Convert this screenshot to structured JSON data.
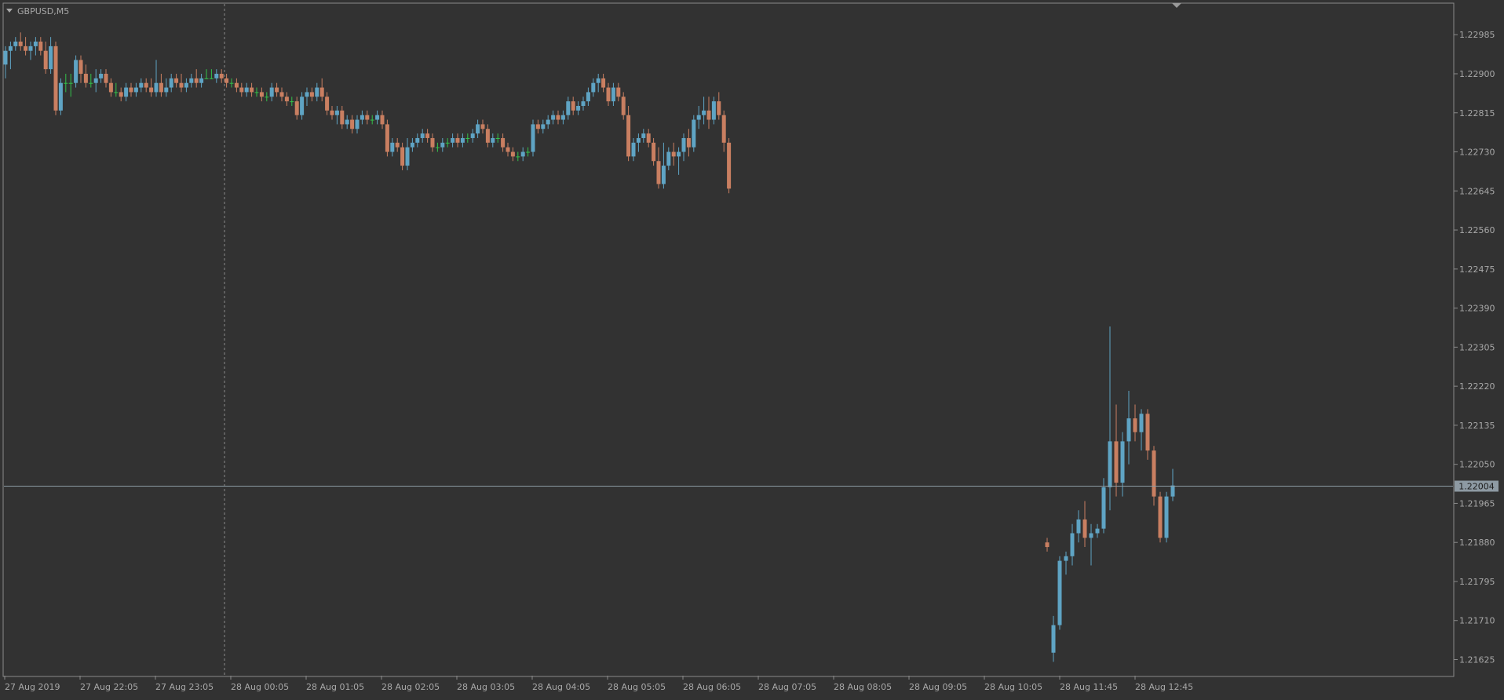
{
  "window": {
    "symbol_label": "GBPUSD,M5"
  },
  "colors": {
    "background": "#323232",
    "frame": "#8a8a8a",
    "text": "#a8a8a8",
    "bull": "#5fa4c4",
    "bear": "#c97f61",
    "doji": "#33c24a",
    "bid_line": "#8c9ca4",
    "bid_label_bg": "#8e9aa3",
    "bid_label_text": "#1c1c1c",
    "period_separator": "#8a8a8a"
  },
  "chart_data": {
    "type": "candlestick",
    "symbol": "GBPUSD",
    "timeframe": "M5",
    "y_range": [
      1.2159,
      1.23052
    ],
    "y_ticks": [
      "1.22985",
      "1.22900",
      "1.22815",
      "1.22730",
      "1.22645",
      "1.22560",
      "1.22475",
      "1.22390",
      "1.22305",
      "1.22220",
      "1.22135",
      "1.22050",
      "1.21965",
      "1.21880",
      "1.21795",
      "1.21710",
      "1.21625"
    ],
    "x_ticks": [
      "27 Aug 2019",
      "27 Aug 22:05",
      "27 Aug 23:05",
      "28 Aug 00:05",
      "28 Aug 01:05",
      "28 Aug 02:05",
      "28 Aug 03:05",
      "28 Aug 04:05",
      "28 Aug 05:05",
      "28 Aug 06:05",
      "28 Aug 07:05",
      "28 Aug 08:05",
      "28 Aug 09:05",
      "28 Aug 10:05",
      "28 Aug 11:45",
      "28 Aug 12:45"
    ],
    "current_bid": "1.22004",
    "candles": [
      [
        1.2292,
        1.2296,
        1.2289,
        1.2295
      ],
      [
        1.2295,
        1.2297,
        1.2291,
        1.2296
      ],
      [
        1.2296,
        1.2298,
        1.2295,
        1.2297
      ],
      [
        1.2297,
        1.2299,
        1.2295,
        1.2296
      ],
      [
        1.2296,
        1.2298,
        1.2294,
        1.2295
      ],
      [
        1.2295,
        1.2297,
        1.2293,
        1.2296
      ],
      [
        1.2296,
        1.2298,
        1.2294,
        1.2297
      ],
      [
        1.2297,
        1.2298,
        1.2294,
        1.2295
      ],
      [
        1.2295,
        1.2297,
        1.229,
        1.2291
      ],
      [
        1.2291,
        1.2298,
        1.229,
        1.2296
      ],
      [
        1.2296,
        1.2297,
        1.2281,
        1.2282
      ],
      [
        1.2282,
        1.2289,
        1.2281,
        1.2288
      ],
      [
        1.2288,
        1.229,
        1.2286,
        1.2288
      ],
      [
        1.2288,
        1.229,
        1.2285,
        1.2288
      ],
      [
        1.2288,
        1.2294,
        1.2287,
        1.2293
      ],
      [
        1.2293,
        1.2294,
        1.2288,
        1.229
      ],
      [
        1.229,
        1.2292,
        1.2287,
        1.2288
      ],
      [
        1.2288,
        1.229,
        1.2287,
        1.2288
      ],
      [
        1.2288,
        1.2291,
        1.2286,
        1.2289
      ],
      [
        1.2289,
        1.2291,
        1.2288,
        1.229
      ],
      [
        1.229,
        1.2291,
        1.2287,
        1.2288
      ],
      [
        1.2288,
        1.2289,
        1.2285,
        1.2286
      ],
      [
        1.2286,
        1.2288,
        1.2285,
        1.2286
      ],
      [
        1.2286,
        1.2287,
        1.2284,
        1.2285
      ],
      [
        1.2285,
        1.2288,
        1.2284,
        1.2287
      ],
      [
        1.2287,
        1.2288,
        1.2285,
        1.2286
      ],
      [
        1.2286,
        1.2288,
        1.2285,
        1.2287
      ],
      [
        1.2287,
        1.2289,
        1.2286,
        1.2288
      ],
      [
        1.2288,
        1.2289,
        1.2286,
        1.2287
      ],
      [
        1.2287,
        1.2289,
        1.2285,
        1.2286
      ],
      [
        1.2286,
        1.2293,
        1.2285,
        1.2288
      ],
      [
        1.2288,
        1.229,
        1.2285,
        1.2286
      ],
      [
        1.2286,
        1.2289,
        1.2285,
        1.2287
      ],
      [
        1.2287,
        1.229,
        1.2286,
        1.2289
      ],
      [
        1.2289,
        1.229,
        1.2287,
        1.2288
      ],
      [
        1.2288,
        1.229,
        1.2286,
        1.2287
      ],
      [
        1.2287,
        1.2289,
        1.2286,
        1.2288
      ],
      [
        1.2288,
        1.229,
        1.2287,
        1.2289
      ],
      [
        1.2289,
        1.2291,
        1.2287,
        1.2288
      ],
      [
        1.2288,
        1.229,
        1.2287,
        1.2289
      ],
      [
        1.2289,
        1.2291,
        1.2289,
        1.2289
      ],
      [
        1.2289,
        1.2291,
        1.2289,
        1.2289
      ],
      [
        1.2289,
        1.2291,
        1.2288,
        1.229
      ],
      [
        1.229,
        1.2291,
        1.2288,
        1.2289
      ],
      [
        1.2289,
        1.229,
        1.2287,
        1.2288
      ],
      [
        1.2288,
        1.2289,
        1.2287,
        1.2288
      ],
      [
        1.2288,
        1.2289,
        1.2286,
        1.2287
      ],
      [
        1.2287,
        1.2288,
        1.2285,
        1.2286
      ],
      [
        1.2286,
        1.2288,
        1.2285,
        1.2287
      ],
      [
        1.2287,
        1.2288,
        1.2285,
        1.2286
      ],
      [
        1.2286,
        1.2287,
        1.2285,
        1.2286
      ],
      [
        1.2286,
        1.2287,
        1.2284,
        1.2285
      ],
      [
        1.2285,
        1.2286,
        1.2284,
        1.2285
      ],
      [
        1.2285,
        1.2288,
        1.2284,
        1.2287
      ],
      [
        1.2287,
        1.2288,
        1.2285,
        1.2286
      ],
      [
        1.2286,
        1.2287,
        1.2284,
        1.2285
      ],
      [
        1.2285,
        1.2286,
        1.2283,
        1.2284
      ],
      [
        1.2284,
        1.2285,
        1.2283,
        1.2284
      ],
      [
        1.2284,
        1.2285,
        1.228,
        1.2281
      ],
      [
        1.2281,
        1.2286,
        1.228,
        1.2285
      ],
      [
        1.2285,
        1.2287,
        1.2283,
        1.2286
      ],
      [
        1.2286,
        1.2287,
        1.2284,
        1.2285
      ],
      [
        1.2285,
        1.2288,
        1.2284,
        1.2287
      ],
      [
        1.2287,
        1.2289,
        1.2284,
        1.2285
      ],
      [
        1.2285,
        1.2286,
        1.2281,
        1.2282
      ],
      [
        1.2282,
        1.2283,
        1.228,
        1.2281
      ],
      [
        1.2281,
        1.2283,
        1.2279,
        1.2282
      ],
      [
        1.2282,
        1.2283,
        1.2278,
        1.2279
      ],
      [
        1.2279,
        1.2281,
        1.2278,
        1.228
      ],
      [
        1.228,
        1.2281,
        1.2277,
        1.2278
      ],
      [
        1.2278,
        1.2281,
        1.2277,
        1.228
      ],
      [
        1.228,
        1.2282,
        1.2279,
        1.2281
      ],
      [
        1.2281,
        1.2282,
        1.2279,
        1.228
      ],
      [
        1.228,
        1.2281,
        1.2279,
        1.228
      ],
      [
        1.228,
        1.2282,
        1.2279,
        1.2281
      ],
      [
        1.2281,
        1.2282,
        1.2278,
        1.2279
      ],
      [
        1.2279,
        1.228,
        1.2272,
        1.2273
      ],
      [
        1.2273,
        1.2276,
        1.2272,
        1.2275
      ],
      [
        1.2275,
        1.2276,
        1.2273,
        1.2274
      ],
      [
        1.2274,
        1.2275,
        1.2269,
        1.227
      ],
      [
        1.227,
        1.2276,
        1.2269,
        1.2274
      ],
      [
        1.2274,
        1.2276,
        1.2273,
        1.2275
      ],
      [
        1.2275,
        1.2277,
        1.2274,
        1.2276
      ],
      [
        1.2276,
        1.2278,
        1.2275,
        1.2277
      ],
      [
        1.2277,
        1.2278,
        1.2275,
        1.2276
      ],
      [
        1.2276,
        1.2277,
        1.2273,
        1.2274
      ],
      [
        1.2274,
        1.2275,
        1.2273,
        1.2274
      ],
      [
        1.2274,
        1.2276,
        1.2273,
        1.2275
      ],
      [
        1.2275,
        1.2276,
        1.2274,
        1.2275
      ],
      [
        1.2275,
        1.2277,
        1.2274,
        1.2276
      ],
      [
        1.2276,
        1.2277,
        1.2274,
        1.2275
      ],
      [
        1.2275,
        1.2277,
        1.2274,
        1.2276
      ],
      [
        1.2276,
        1.2277,
        1.2275,
        1.2276
      ],
      [
        1.2276,
        1.2278,
        1.2275,
        1.2277
      ],
      [
        1.2277,
        1.228,
        1.2276,
        1.2279
      ],
      [
        1.2279,
        1.228,
        1.2277,
        1.2278
      ],
      [
        1.2278,
        1.2279,
        1.2274,
        1.2275
      ],
      [
        1.2275,
        1.2277,
        1.2274,
        1.2276
      ],
      [
        1.2276,
        1.2277,
        1.2275,
        1.2276
      ],
      [
        1.2276,
        1.2277,
        1.2273,
        1.2274
      ],
      [
        1.2274,
        1.2275,
        1.2272,
        1.2273
      ],
      [
        1.2273,
        1.2274,
        1.2271,
        1.2272
      ],
      [
        1.2272,
        1.2273,
        1.2271,
        1.2272
      ],
      [
        1.2272,
        1.2274,
        1.2271,
        1.2273
      ],
      [
        1.2273,
        1.2274,
        1.2272,
        1.2273
      ],
      [
        1.2273,
        1.228,
        1.2272,
        1.2279
      ],
      [
        1.2279,
        1.228,
        1.2277,
        1.2278
      ],
      [
        1.2278,
        1.228,
        1.2277,
        1.2279
      ],
      [
        1.2279,
        1.2281,
        1.2278,
        1.228
      ],
      [
        1.228,
        1.2282,
        1.2279,
        1.2281
      ],
      [
        1.2281,
        1.2282,
        1.2279,
        1.228
      ],
      [
        1.228,
        1.2282,
        1.2279,
        1.2281
      ],
      [
        1.2281,
        1.2285,
        1.228,
        1.2284
      ],
      [
        1.2284,
        1.2285,
        1.2281,
        1.2282
      ],
      [
        1.2282,
        1.2284,
        1.2281,
        1.2283
      ],
      [
        1.2283,
        1.2285,
        1.2282,
        1.2284
      ],
      [
        1.2284,
        1.2287,
        1.2283,
        1.2286
      ],
      [
        1.2286,
        1.2289,
        1.2285,
        1.2288
      ],
      [
        1.2288,
        1.229,
        1.2286,
        1.2289
      ],
      [
        1.2289,
        1.229,
        1.2286,
        1.2287
      ],
      [
        1.2287,
        1.2288,
        1.2283,
        1.2284
      ],
      [
        1.2284,
        1.2288,
        1.2283,
        1.2287
      ],
      [
        1.2287,
        1.2288,
        1.2284,
        1.2285
      ],
      [
        1.2285,
        1.2286,
        1.228,
        1.2281
      ],
      [
        1.2281,
        1.2283,
        1.2271,
        1.2272
      ],
      [
        1.2272,
        1.2276,
        1.2271,
        1.2275
      ],
      [
        1.2275,
        1.2277,
        1.2273,
        1.2276
      ],
      [
        1.2276,
        1.2278,
        1.2275,
        1.2277
      ],
      [
        1.2277,
        1.2278,
        1.2274,
        1.2275
      ],
      [
        1.2275,
        1.2276,
        1.227,
        1.2271
      ],
      [
        1.2271,
        1.2274,
        1.2265,
        1.2266
      ],
      [
        1.2266,
        1.2275,
        1.2265,
        1.227
      ],
      [
        1.227,
        1.2274,
        1.2269,
        1.2273
      ],
      [
        1.2273,
        1.2275,
        1.227,
        1.2272
      ],
      [
        1.2272,
        1.2274,
        1.2268,
        1.2273
      ],
      [
        1.2273,
        1.2277,
        1.2271,
        1.2276
      ],
      [
        1.2276,
        1.2278,
        1.2272,
        1.2274
      ],
      [
        1.2274,
        1.2281,
        1.2273,
        1.228
      ],
      [
        1.228,
        1.2283,
        1.2278,
        1.2281
      ],
      [
        1.2281,
        1.2285,
        1.2279,
        1.2282
      ],
      [
        1.2282,
        1.2285,
        1.2278,
        1.228
      ],
      [
        1.228,
        1.2285,
        1.2279,
        1.2284
      ],
      [
        1.2284,
        1.2286,
        1.228,
        1.2281
      ],
      [
        1.2281,
        1.2282,
        1.2273,
        1.2275
      ],
      [
        1.2275,
        1.2276,
        1.2264,
        1.2265
      ]
    ],
    "gap_candles": [
      [
        1.2188,
        1.2189,
        1.2186,
        1.2187
      ],
      [
        1.2164,
        1.2172,
        1.2162,
        1.217
      ],
      [
        1.217,
        1.2185,
        1.2169,
        1.2184
      ],
      [
        1.2184,
        1.2186,
        1.2181,
        1.2185
      ],
      [
        1.2185,
        1.2192,
        1.2183,
        1.219
      ],
      [
        1.219,
        1.2195,
        1.2188,
        1.2193
      ],
      [
        1.2193,
        1.2197,
        1.2187,
        1.2189
      ],
      [
        1.2189,
        1.2192,
        1.2183,
        1.219
      ],
      [
        1.219,
        1.2192,
        1.2189,
        1.2191
      ],
      [
        1.2191,
        1.2202,
        1.219,
        1.22
      ],
      [
        1.22,
        1.2235,
        1.2195,
        1.221
      ],
      [
        1.221,
        1.2218,
        1.2198,
        1.2201
      ],
      [
        1.2201,
        1.2212,
        1.2198,
        1.221
      ],
      [
        1.221,
        1.2221,
        1.2205,
        1.2215
      ],
      [
        1.2215,
        1.2218,
        1.221,
        1.2212
      ],
      [
        1.2212,
        1.2217,
        1.2208,
        1.2216
      ],
      [
        1.2216,
        1.2217,
        1.2206,
        1.2208
      ],
      [
        1.2208,
        1.2209,
        1.2196,
        1.2198
      ],
      [
        1.2198,
        1.2199,
        1.2188,
        1.2189
      ],
      [
        1.2189,
        1.2199,
        1.2188,
        1.2198
      ],
      [
        1.2198,
        1.2204,
        1.2197,
        1.22004
      ]
    ]
  }
}
